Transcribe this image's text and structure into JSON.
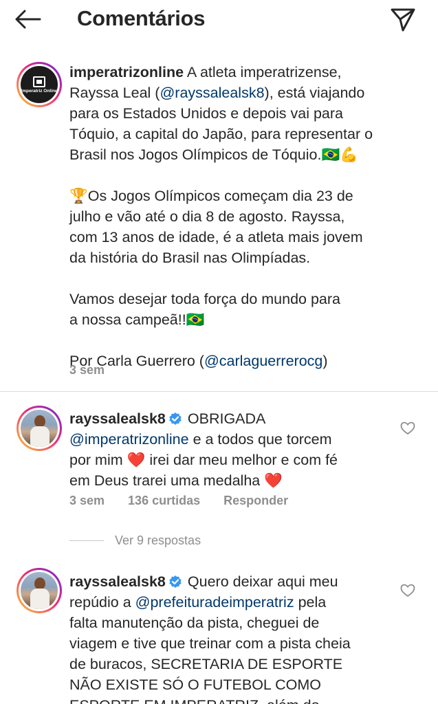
{
  "header": {
    "title": "Comentários"
  },
  "caption": {
    "avatar_text": "Imperatriz Online",
    "username": "imperatrizonline",
    "p1_a": " A atleta imperatrizense,",
    "p1_b": "Rayssa Leal (",
    "p1_mention": "@rayssalealsk8",
    "p1_c": "), está viajando",
    "p1_d": "para os Estados Unidos e depois vai para",
    "p1_e": "Tóquio, a capital do Japão, para representar o",
    "p1_f": "Brasil nos Jogos Olímpicos de Tóquio.🇧🇷💪",
    "p2_a": "🏆Os Jogos Olímpicos começam dia 23 de",
    "p2_b": "julho e vão até o dia 8 de agosto. Rayssa,",
    "p2_c": "com 13 anos de idade, é a atleta mais jovem",
    "p2_d": "da história do Brasil nas Olimpíadas.",
    "p3_a": "Vamos desejar toda força do mundo para",
    "p3_b": "a nossa campeã!!🇧🇷",
    "p4_a": "Por Carla Guerrero (",
    "p4_mention": "@carlaguerrerocg",
    "p4_b": ")",
    "time": "3 sem"
  },
  "comments": [
    {
      "username": "rayssalealsk8",
      "l1": "OBRIGADA",
      "mention": "@imperatrizonline",
      "l2_rest": " e a todos que torcem",
      "l3_a": "por mim ",
      "l3_heart": "❤️",
      "l3_b": " irei dar meu melhor e com fé",
      "l4_a": "em Deus trarei uma medalha ",
      "l4_heart": "❤️",
      "time": "3 sem",
      "likes": "136 curtidas",
      "reply": "Responder",
      "view_replies": "Ver 9 respostas"
    },
    {
      "username": "rayssalealsk8",
      "l1": "Quero deixar aqui meu",
      "l2_a": "repúdio a ",
      "mention": "@prefeituradeimperatriz",
      "l2_b": " pela",
      "l3": "falta manutenção da pista, cheguei de",
      "l4": "viagem e tive que treinar com a pista cheia",
      "l5": "de buracos, SECRETARIA DE ESPORTE",
      "l6": "NÃO EXISTE SÓ O FUTEBOL COMO",
      "l7": "ESPORTE EM IMPERATRIZ, além do"
    }
  ],
  "icons": {
    "back": "arrow-left-icon",
    "send": "paper-plane-icon",
    "like": "heart-outline-icon",
    "verified": "verified-badge-icon"
  },
  "colors": {
    "text": "#262626",
    "mention": "#00376b",
    "meta": "#8e8e8e",
    "verified": "#3897f0",
    "divider": "#dbdbdb"
  }
}
